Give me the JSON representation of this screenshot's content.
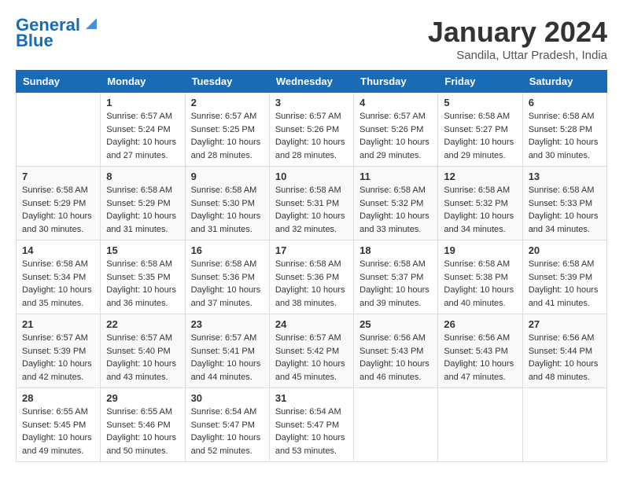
{
  "logo": {
    "line1": "General",
    "line2": "Blue"
  },
  "title": "January 2024",
  "location": "Sandila, Uttar Pradesh, India",
  "days_of_week": [
    "Sunday",
    "Monday",
    "Tuesday",
    "Wednesday",
    "Thursday",
    "Friday",
    "Saturday"
  ],
  "weeks": [
    [
      {
        "day": "",
        "sunrise": "",
        "sunset": "",
        "daylight": ""
      },
      {
        "day": "1",
        "sunrise": "Sunrise: 6:57 AM",
        "sunset": "Sunset: 5:24 PM",
        "daylight": "Daylight: 10 hours and 27 minutes."
      },
      {
        "day": "2",
        "sunrise": "Sunrise: 6:57 AM",
        "sunset": "Sunset: 5:25 PM",
        "daylight": "Daylight: 10 hours and 28 minutes."
      },
      {
        "day": "3",
        "sunrise": "Sunrise: 6:57 AM",
        "sunset": "Sunset: 5:26 PM",
        "daylight": "Daylight: 10 hours and 28 minutes."
      },
      {
        "day": "4",
        "sunrise": "Sunrise: 6:57 AM",
        "sunset": "Sunset: 5:26 PM",
        "daylight": "Daylight: 10 hours and 29 minutes."
      },
      {
        "day": "5",
        "sunrise": "Sunrise: 6:58 AM",
        "sunset": "Sunset: 5:27 PM",
        "daylight": "Daylight: 10 hours and 29 minutes."
      },
      {
        "day": "6",
        "sunrise": "Sunrise: 6:58 AM",
        "sunset": "Sunset: 5:28 PM",
        "daylight": "Daylight: 10 hours and 30 minutes."
      }
    ],
    [
      {
        "day": "7",
        "sunrise": "Sunrise: 6:58 AM",
        "sunset": "Sunset: 5:29 PM",
        "daylight": "Daylight: 10 hours and 30 minutes."
      },
      {
        "day": "8",
        "sunrise": "Sunrise: 6:58 AM",
        "sunset": "Sunset: 5:29 PM",
        "daylight": "Daylight: 10 hours and 31 minutes."
      },
      {
        "day": "9",
        "sunrise": "Sunrise: 6:58 AM",
        "sunset": "Sunset: 5:30 PM",
        "daylight": "Daylight: 10 hours and 31 minutes."
      },
      {
        "day": "10",
        "sunrise": "Sunrise: 6:58 AM",
        "sunset": "Sunset: 5:31 PM",
        "daylight": "Daylight: 10 hours and 32 minutes."
      },
      {
        "day": "11",
        "sunrise": "Sunrise: 6:58 AM",
        "sunset": "Sunset: 5:32 PM",
        "daylight": "Daylight: 10 hours and 33 minutes."
      },
      {
        "day": "12",
        "sunrise": "Sunrise: 6:58 AM",
        "sunset": "Sunset: 5:32 PM",
        "daylight": "Daylight: 10 hours and 34 minutes."
      },
      {
        "day": "13",
        "sunrise": "Sunrise: 6:58 AM",
        "sunset": "Sunset: 5:33 PM",
        "daylight": "Daylight: 10 hours and 34 minutes."
      }
    ],
    [
      {
        "day": "14",
        "sunrise": "Sunrise: 6:58 AM",
        "sunset": "Sunset: 5:34 PM",
        "daylight": "Daylight: 10 hours and 35 minutes."
      },
      {
        "day": "15",
        "sunrise": "Sunrise: 6:58 AM",
        "sunset": "Sunset: 5:35 PM",
        "daylight": "Daylight: 10 hours and 36 minutes."
      },
      {
        "day": "16",
        "sunrise": "Sunrise: 6:58 AM",
        "sunset": "Sunset: 5:36 PM",
        "daylight": "Daylight: 10 hours and 37 minutes."
      },
      {
        "day": "17",
        "sunrise": "Sunrise: 6:58 AM",
        "sunset": "Sunset: 5:36 PM",
        "daylight": "Daylight: 10 hours and 38 minutes."
      },
      {
        "day": "18",
        "sunrise": "Sunrise: 6:58 AM",
        "sunset": "Sunset: 5:37 PM",
        "daylight": "Daylight: 10 hours and 39 minutes."
      },
      {
        "day": "19",
        "sunrise": "Sunrise: 6:58 AM",
        "sunset": "Sunset: 5:38 PM",
        "daylight": "Daylight: 10 hours and 40 minutes."
      },
      {
        "day": "20",
        "sunrise": "Sunrise: 6:58 AM",
        "sunset": "Sunset: 5:39 PM",
        "daylight": "Daylight: 10 hours and 41 minutes."
      }
    ],
    [
      {
        "day": "21",
        "sunrise": "Sunrise: 6:57 AM",
        "sunset": "Sunset: 5:39 PM",
        "daylight": "Daylight: 10 hours and 42 minutes."
      },
      {
        "day": "22",
        "sunrise": "Sunrise: 6:57 AM",
        "sunset": "Sunset: 5:40 PM",
        "daylight": "Daylight: 10 hours and 43 minutes."
      },
      {
        "day": "23",
        "sunrise": "Sunrise: 6:57 AM",
        "sunset": "Sunset: 5:41 PM",
        "daylight": "Daylight: 10 hours and 44 minutes."
      },
      {
        "day": "24",
        "sunrise": "Sunrise: 6:57 AM",
        "sunset": "Sunset: 5:42 PM",
        "daylight": "Daylight: 10 hours and 45 minutes."
      },
      {
        "day": "25",
        "sunrise": "Sunrise: 6:56 AM",
        "sunset": "Sunset: 5:43 PM",
        "daylight": "Daylight: 10 hours and 46 minutes."
      },
      {
        "day": "26",
        "sunrise": "Sunrise: 6:56 AM",
        "sunset": "Sunset: 5:43 PM",
        "daylight": "Daylight: 10 hours and 47 minutes."
      },
      {
        "day": "27",
        "sunrise": "Sunrise: 6:56 AM",
        "sunset": "Sunset: 5:44 PM",
        "daylight": "Daylight: 10 hours and 48 minutes."
      }
    ],
    [
      {
        "day": "28",
        "sunrise": "Sunrise: 6:55 AM",
        "sunset": "Sunset: 5:45 PM",
        "daylight": "Daylight: 10 hours and 49 minutes."
      },
      {
        "day": "29",
        "sunrise": "Sunrise: 6:55 AM",
        "sunset": "Sunset: 5:46 PM",
        "daylight": "Daylight: 10 hours and 50 minutes."
      },
      {
        "day": "30",
        "sunrise": "Sunrise: 6:54 AM",
        "sunset": "Sunset: 5:47 PM",
        "daylight": "Daylight: 10 hours and 52 minutes."
      },
      {
        "day": "31",
        "sunrise": "Sunrise: 6:54 AM",
        "sunset": "Sunset: 5:47 PM",
        "daylight": "Daylight: 10 hours and 53 minutes."
      },
      {
        "day": "",
        "sunrise": "",
        "sunset": "",
        "daylight": ""
      },
      {
        "day": "",
        "sunrise": "",
        "sunset": "",
        "daylight": ""
      },
      {
        "day": "",
        "sunrise": "",
        "sunset": "",
        "daylight": ""
      }
    ]
  ]
}
